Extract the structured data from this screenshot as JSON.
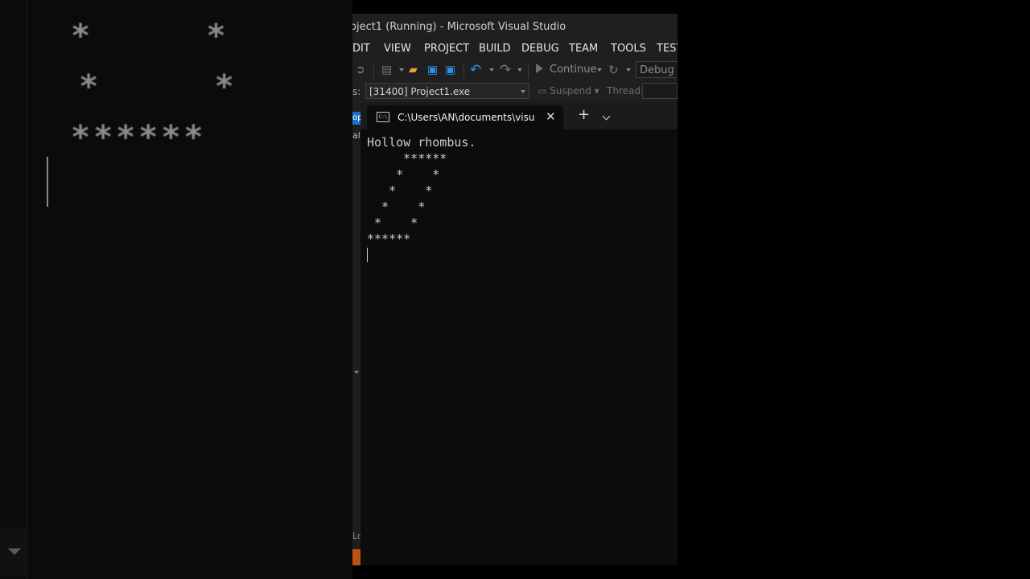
{
  "background": {
    "echo_lines": [
      "*     *",
      " *     *",
      "******"
    ]
  },
  "vs": {
    "title": "oject1 (Running) - Microsoft Visual Studio",
    "menu": [
      "DIT",
      "VIEW",
      "PROJECT",
      "BUILD",
      "DEBUG",
      "TEAM",
      "TOOLS",
      "TEST"
    ],
    "toolbar": {
      "continue_label": "Continue",
      "config_value": "Debug"
    },
    "process": {
      "label": "s:",
      "value": "[31400] Project1.exe",
      "suspend_label": "Suspend",
      "thread_label": "Thread:"
    },
    "left_strip": {
      "tab_text": "op",
      "al_text": "al",
      "lo_text": "Lo"
    }
  },
  "terminal": {
    "tab_title": "C:\\Users\\AN\\documents\\visua",
    "icon_text": "C:\\",
    "output": "Hollow rhombus.\n     ******\n    *    *\n   *    *\n  *    *\n *    *\n******"
  },
  "colors": {
    "accent_blue": "#1a6fc2",
    "accent_orange": "#c04f12",
    "terminal_bg": "#0c0c0c",
    "vs_bg": "#1f1f1f"
  }
}
